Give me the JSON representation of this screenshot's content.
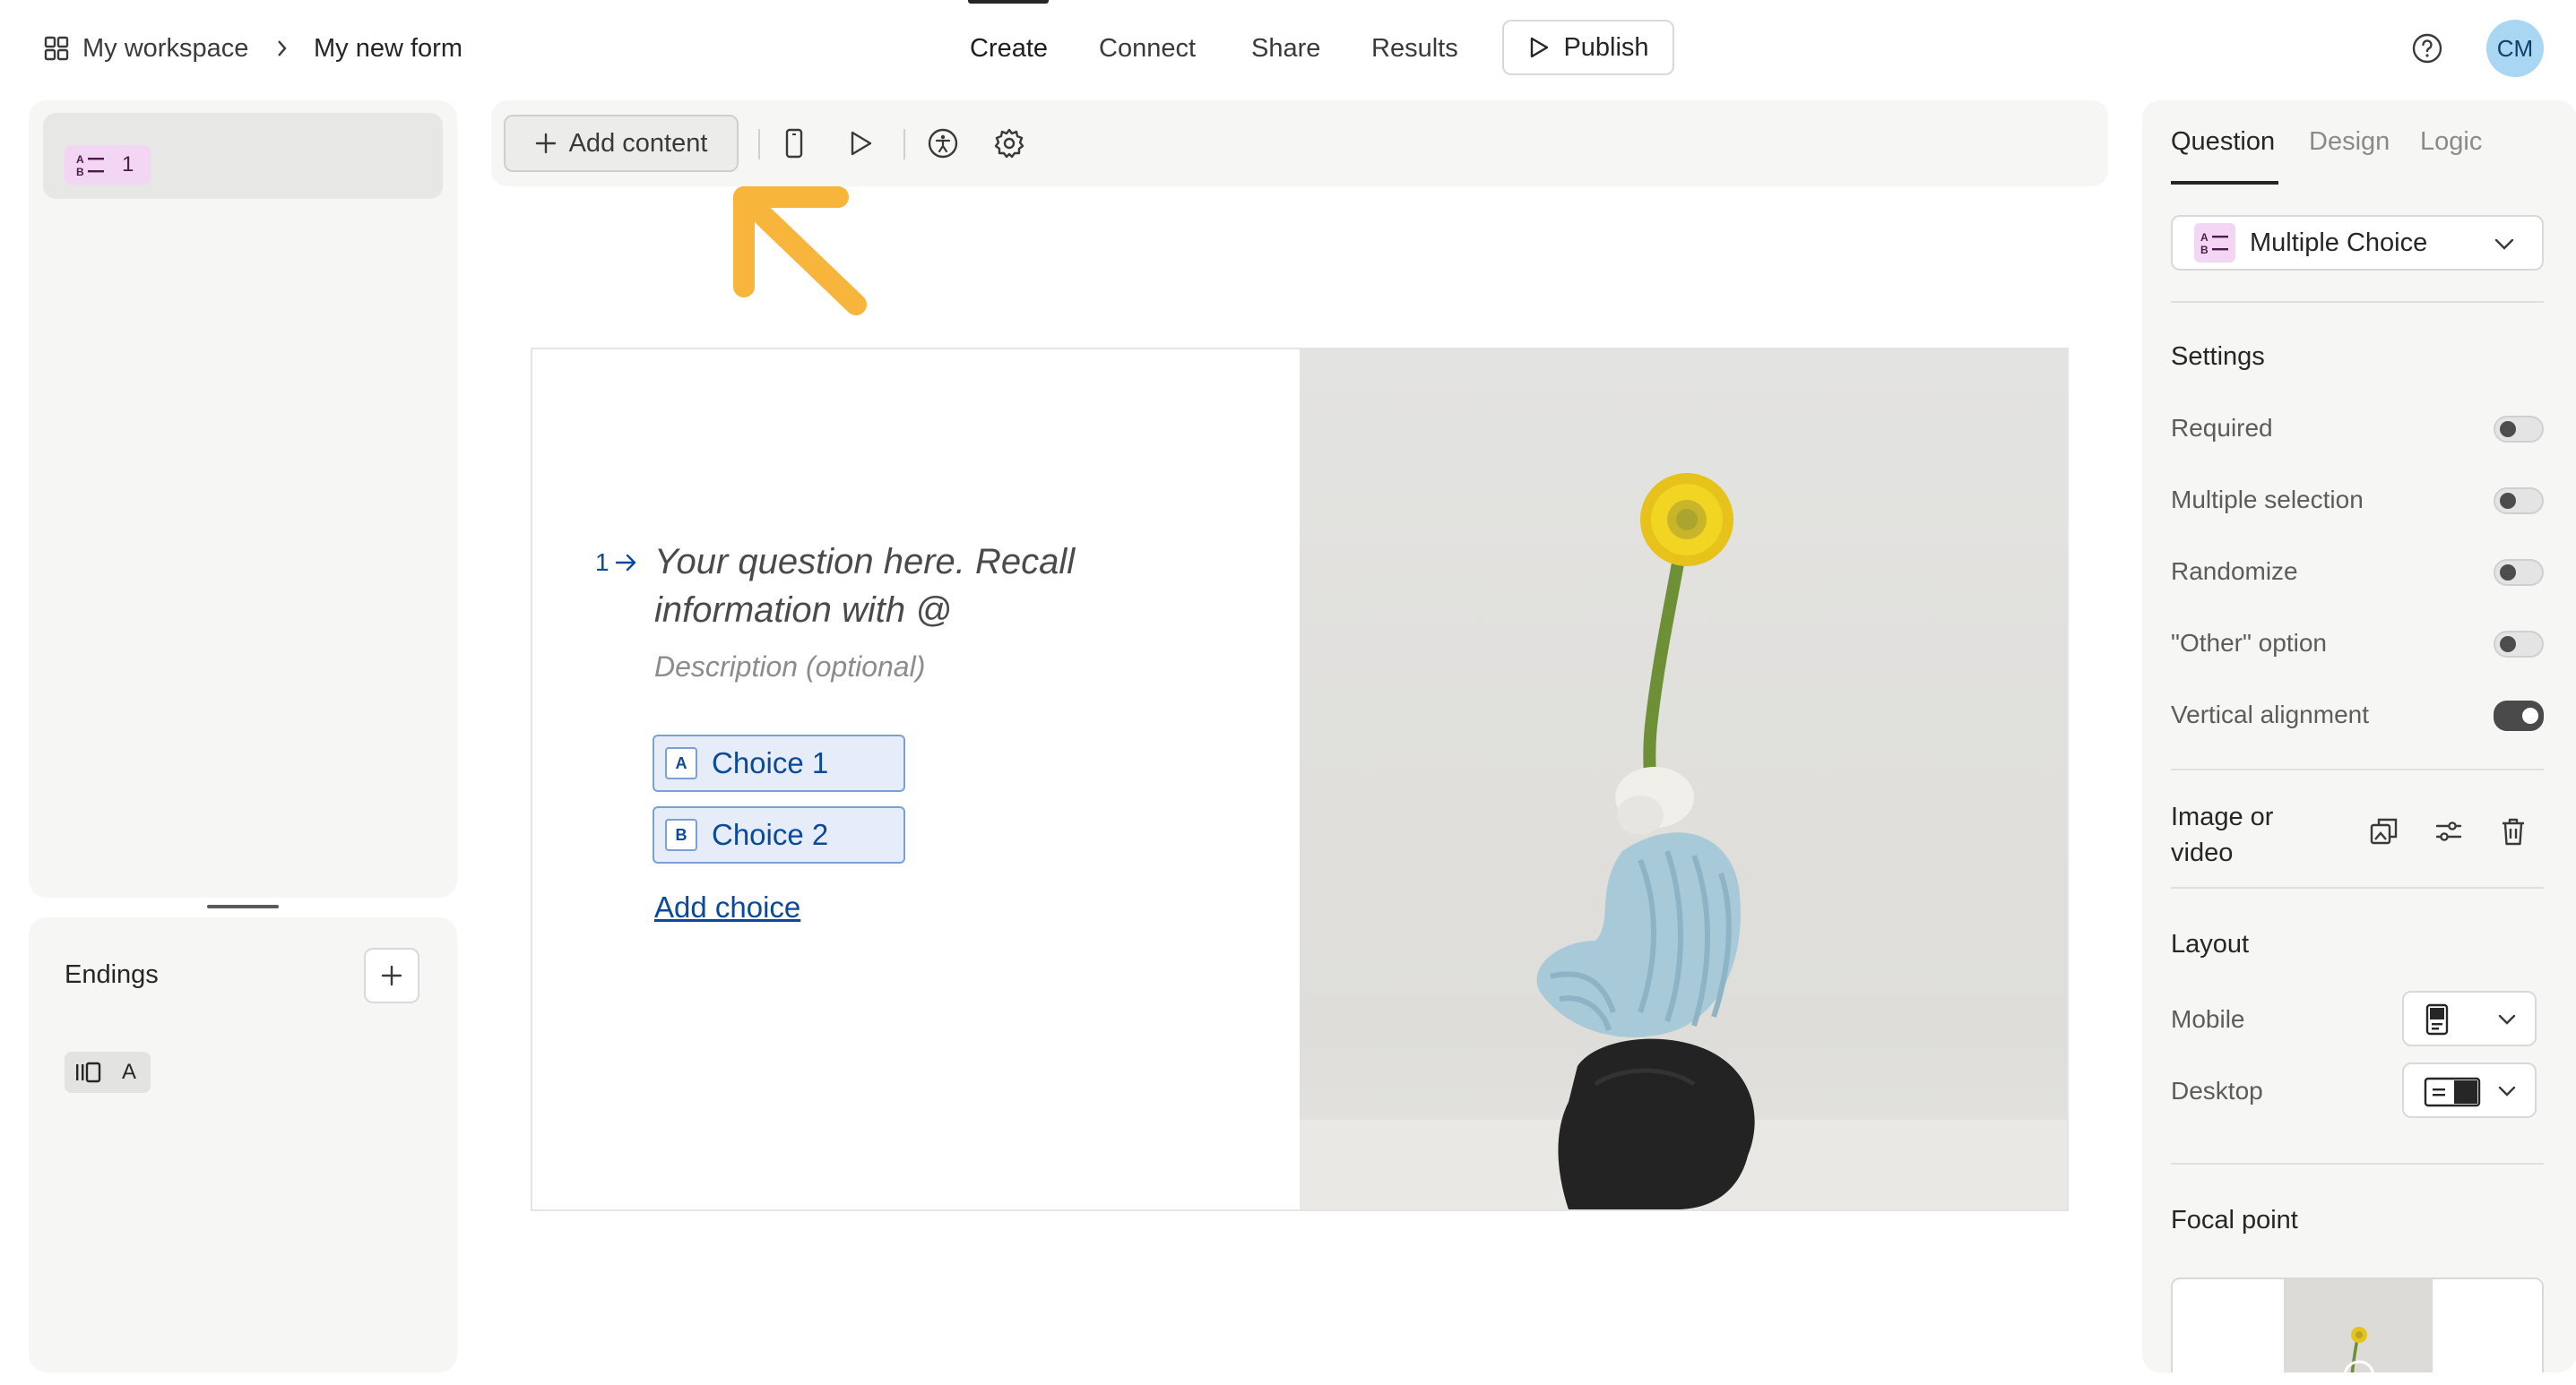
{
  "breadcrumb": {
    "workspace": "My workspace",
    "form_name": "My new form"
  },
  "nav": {
    "tabs": [
      "Create",
      "Connect",
      "Share",
      "Results"
    ],
    "active": "Create",
    "publish_label": "Publish"
  },
  "user": {
    "initials": "CM"
  },
  "left_panel": {
    "question_number": "1",
    "endings_label": "Endings",
    "ending_letter": "A"
  },
  "toolbar": {
    "add_content_label": "Add content"
  },
  "question": {
    "number": "1",
    "title": "Your question here. Recall information with @",
    "description": "Description (optional)",
    "choices": [
      {
        "key": "A",
        "label": "Choice 1"
      },
      {
        "key": "B",
        "label": "Choice 2"
      }
    ],
    "add_choice_label": "Add choice"
  },
  "right_panel": {
    "tabs": [
      "Question",
      "Design",
      "Logic"
    ],
    "active_tab": "Question",
    "question_type": "Multiple Choice",
    "settings_heading": "Settings",
    "settings": [
      {
        "label": "Required",
        "on": false
      },
      {
        "label": "Multiple selection",
        "on": false
      },
      {
        "label": "Randomize",
        "on": false
      },
      {
        "label": "\"Other\" option",
        "on": false
      },
      {
        "label": "Vertical alignment",
        "on": true
      }
    ],
    "image_label_line1": "Image or",
    "image_label_line2": "video",
    "layout_heading": "Layout",
    "layout_mobile": "Mobile",
    "layout_desktop": "Desktop",
    "focal_heading": "Focal point"
  },
  "colors": {
    "accent_link": "#0b4a9a",
    "annotation_arrow": "#f7b53b",
    "avatar_bg": "#a9d6f2",
    "question_badge": "#f3d6f3"
  }
}
